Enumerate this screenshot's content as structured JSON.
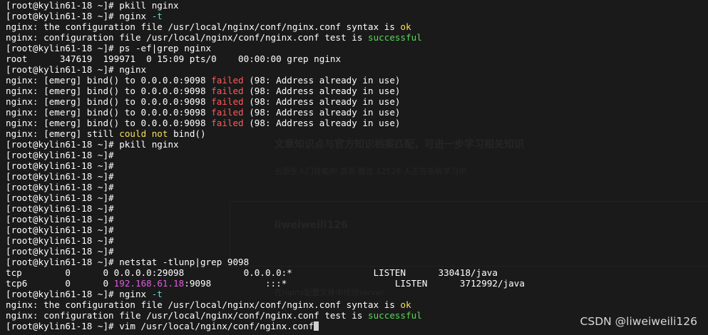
{
  "terminal": {
    "lines": [
      [
        {
          "t": "[root@kylin61-18 ~]# pkill nginx"
        }
      ],
      [
        {
          "t": "[root@kylin61-18 ~]# nginx "
        },
        {
          "t": "-t",
          "c": "cyan"
        }
      ],
      [
        {
          "t": "nginx: the configuration file /usr/local/nginx/conf/nginx.conf syntax is "
        },
        {
          "t": "ok",
          "c": "yellow"
        }
      ],
      [
        {
          "t": "nginx: configuration file /usr/local/nginx/conf/nginx.conf test is "
        },
        {
          "t": "successful",
          "c": "green"
        }
      ],
      [
        {
          "t": "[root@kylin61-18 ~]# ps -ef|grep nginx"
        }
      ],
      [
        {
          "t": "root      347619  199971  0 15:09 pts/0    00:00:00 grep nginx"
        }
      ],
      [
        {
          "t": "[root@kylin61-18 ~]# nginx"
        }
      ],
      [
        {
          "t": "nginx: [emerg] bind() to 0.0.0.0:9098 "
        },
        {
          "t": "failed",
          "c": "red"
        },
        {
          "t": " (98: Address already in use)"
        }
      ],
      [
        {
          "t": "nginx: [emerg] bind() to 0.0.0.0:9098 "
        },
        {
          "t": "failed",
          "c": "red"
        },
        {
          "t": " (98: Address already in use)"
        }
      ],
      [
        {
          "t": "nginx: [emerg] bind() to 0.0.0.0:9098 "
        },
        {
          "t": "failed",
          "c": "red"
        },
        {
          "t": " (98: Address already in use)"
        }
      ],
      [
        {
          "t": "nginx: [emerg] bind() to 0.0.0.0:9098 "
        },
        {
          "t": "failed",
          "c": "red"
        },
        {
          "t": " (98: Address already in use)"
        }
      ],
      [
        {
          "t": "nginx: [emerg] bind() to 0.0.0.0:9098 "
        },
        {
          "t": "failed",
          "c": "red"
        },
        {
          "t": " (98: Address already in use)"
        }
      ],
      [
        {
          "t": "nginx: [emerg] still "
        },
        {
          "t": "could not",
          "c": "yellow"
        },
        {
          "t": " bind()"
        }
      ],
      [
        {
          "t": "[root@kylin61-18 ~]# pkill nginx"
        }
      ],
      [
        {
          "t": "[root@kylin61-18 ~]#"
        }
      ],
      [
        {
          "t": "[root@kylin61-18 ~]#"
        }
      ],
      [
        {
          "t": "[root@kylin61-18 ~]#"
        }
      ],
      [
        {
          "t": "[root@kylin61-18 ~]#"
        }
      ],
      [
        {
          "t": "[root@kylin61-18 ~]#"
        }
      ],
      [
        {
          "t": "[root@kylin61-18 ~]#"
        }
      ],
      [
        {
          "t": "[root@kylin61-18 ~]#"
        }
      ],
      [
        {
          "t": "[root@kylin61-18 ~]#"
        }
      ],
      [
        {
          "t": "[root@kylin61-18 ~]#"
        }
      ],
      [
        {
          "t": "[root@kylin61-18 ~]#"
        }
      ],
      [
        {
          "t": "[root@kylin61-18 ~]# netstat -tlunp|grep 9098"
        }
      ],
      [
        {
          "t": "tcp        0      0 0.0.0.0:29098           0.0.0.0:*               LISTEN      330418/java"
        }
      ],
      [
        {
          "t": "tcp6       0      0 "
        },
        {
          "t": "192.168.61.18",
          "c": "magenta"
        },
        {
          "t": ":9098          :::*                    LISTEN      3712992/java"
        }
      ],
      [
        {
          "t": "[root@kylin61-18 ~]# nginx "
        },
        {
          "t": "-t",
          "c": "cyan"
        }
      ],
      [
        {
          "t": "nginx: the configuration file /usr/local/nginx/conf/nginx.conf syntax is "
        },
        {
          "t": "ok",
          "c": "yellow"
        }
      ],
      [
        {
          "t": "nginx: configuration file /usr/local/nginx/conf/nginx.conf test is "
        },
        {
          "t": "successful",
          "c": "green"
        }
      ],
      [
        {
          "t": "[root@kylin61-18 ~]# vim /usr/local/nginx/conf/nginx.conf"
        }
      ]
    ]
  },
  "background_page": {
    "heading": "文章知识点与官方知识档案匹配，可进一步学习相关知识",
    "stats": "云原生入门技能树 首页 概览 12528 人正在系统学习中",
    "author": "liweiweili126",
    "snippet": "在nginx配置文件中修改server"
  },
  "watermark": "CSDN @liweiweili126",
  "colors": {
    "background": "#1a1a1a",
    "text": "#ffffff",
    "cyan": "#67d3dc",
    "yellow": "#f5e05a",
    "green": "#5bd65b",
    "red": "#ff5a5a",
    "magenta": "#e15ae1"
  }
}
